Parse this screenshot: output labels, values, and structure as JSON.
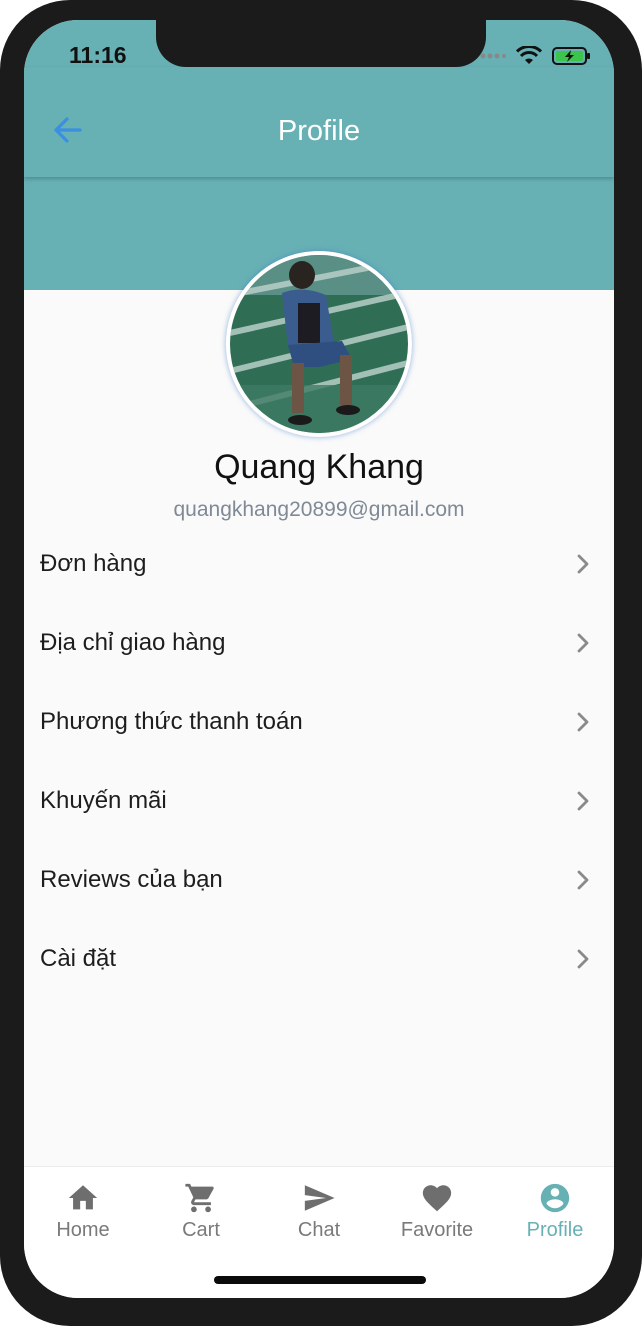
{
  "status_bar": {
    "time": "11:16",
    "icons": [
      "signal-dots-icon",
      "wifi-icon",
      "battery-charging-icon"
    ]
  },
  "app_bar": {
    "title": "Profile",
    "back_icon": "arrow-left-icon"
  },
  "profile": {
    "name": "Quang Khang",
    "email": "quangkhang20899@gmail.com"
  },
  "menu": {
    "items": [
      {
        "label": "Đơn hàng"
      },
      {
        "label": "Địa chỉ giao hàng"
      },
      {
        "label": "Phương thức thanh toán"
      },
      {
        "label": "Khuyến mãi"
      },
      {
        "label": "Reviews của bạn"
      },
      {
        "label": "Cài đặt"
      }
    ]
  },
  "bottom_nav": {
    "items": [
      {
        "label": "Home",
        "icon": "home-icon"
      },
      {
        "label": "Cart",
        "icon": "cart-icon"
      },
      {
        "label": "Chat",
        "icon": "send-icon"
      },
      {
        "label": "Favorite",
        "icon": "heart-icon"
      },
      {
        "label": "Profile",
        "icon": "account-circle-icon"
      }
    ],
    "active_index": 4
  },
  "colors": {
    "accent_teal": "#67b1b5",
    "back_arrow": "#3a8fe0",
    "inactive_nav": "#7a7a7a",
    "email_gray": "#7f8a96"
  }
}
